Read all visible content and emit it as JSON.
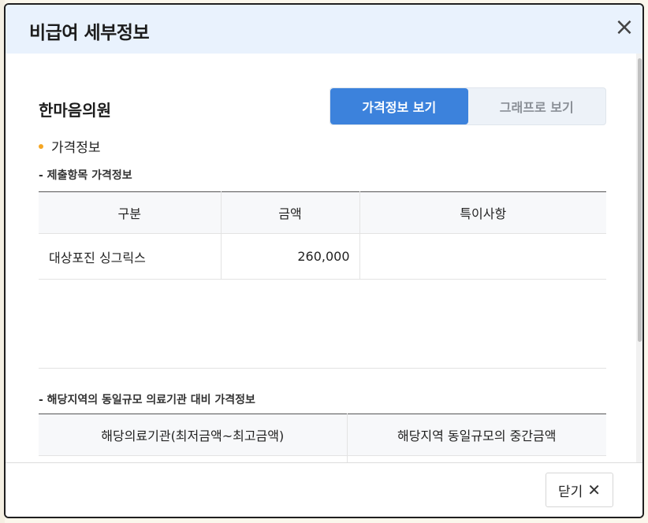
{
  "modal": {
    "title": "비급여 세부정보",
    "close_icon": "×"
  },
  "clinic": {
    "name": "한마음의원"
  },
  "view_toggle": {
    "price_view": "가격정보 보기",
    "graph_view": "그래프로 보기"
  },
  "section": {
    "label": "가격정보"
  },
  "submitted": {
    "heading": "- 제출항목 가격정보",
    "columns": [
      "구분",
      "금액",
      "특이사항"
    ],
    "rows": [
      {
        "category": "대상포진 싱그릭스",
        "amount": "260,000",
        "note": ""
      }
    ]
  },
  "regional": {
    "heading": "- 해당지역의 동일규모 의료기관 대비 가격정보",
    "columns": [
      "해당의료기관(최저금액~최고금액)",
      "해당지역 동일규모의 중간금액"
    ]
  },
  "footer": {
    "close_label": "닫기",
    "close_icon": "✕"
  }
}
